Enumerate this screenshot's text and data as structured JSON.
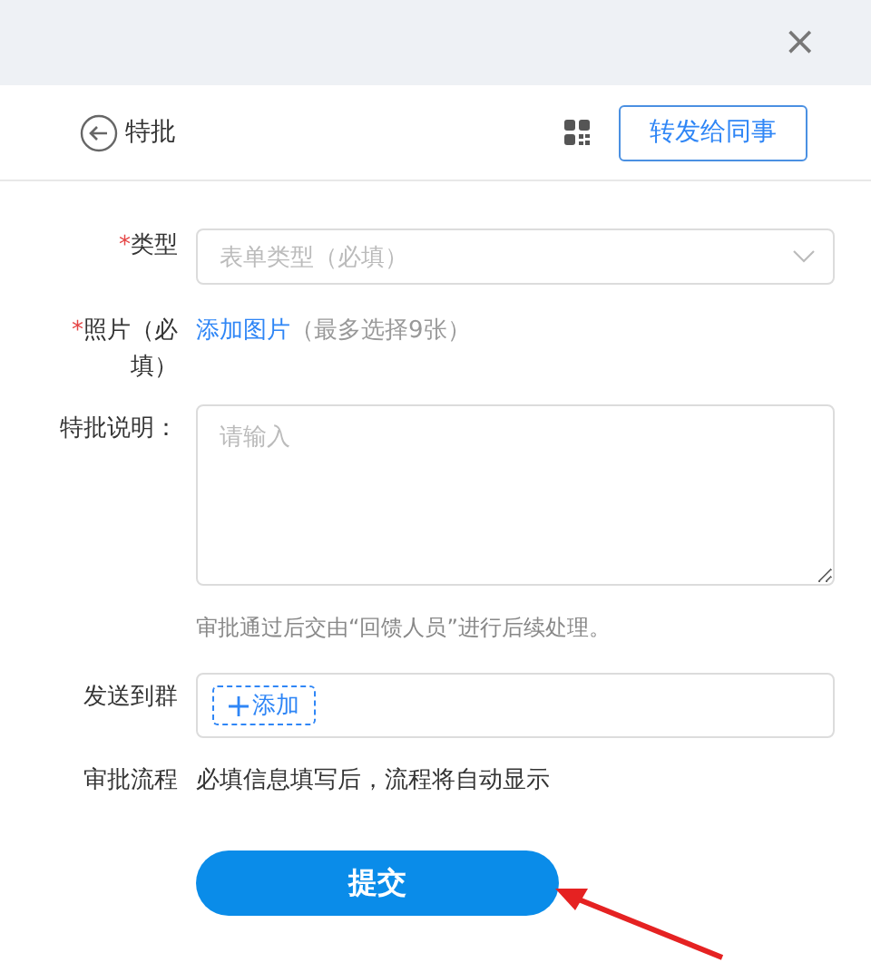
{
  "dialog": {
    "close_symbol": "×"
  },
  "header": {
    "title": "特批",
    "forward_button": "转发给同事"
  },
  "form": {
    "type_field": {
      "required_mark": "*",
      "label": "类型",
      "placeholder": "表单类型（必填）"
    },
    "photo_field": {
      "required_mark": "*",
      "label": "照片（必填）",
      "link": "添加图片",
      "note": "（最多选择9张）"
    },
    "remark_field": {
      "label": "特批说明：",
      "placeholder": "请输入",
      "hint": "审批通过后交由“回馈人员”进行后续处理。"
    },
    "group_field": {
      "label": "发送到群",
      "add_button": "添加"
    },
    "flow_field": {
      "label": "审批流程",
      "text": "必填信息填写后，流程将自动显示"
    },
    "submit_button": "提交"
  }
}
